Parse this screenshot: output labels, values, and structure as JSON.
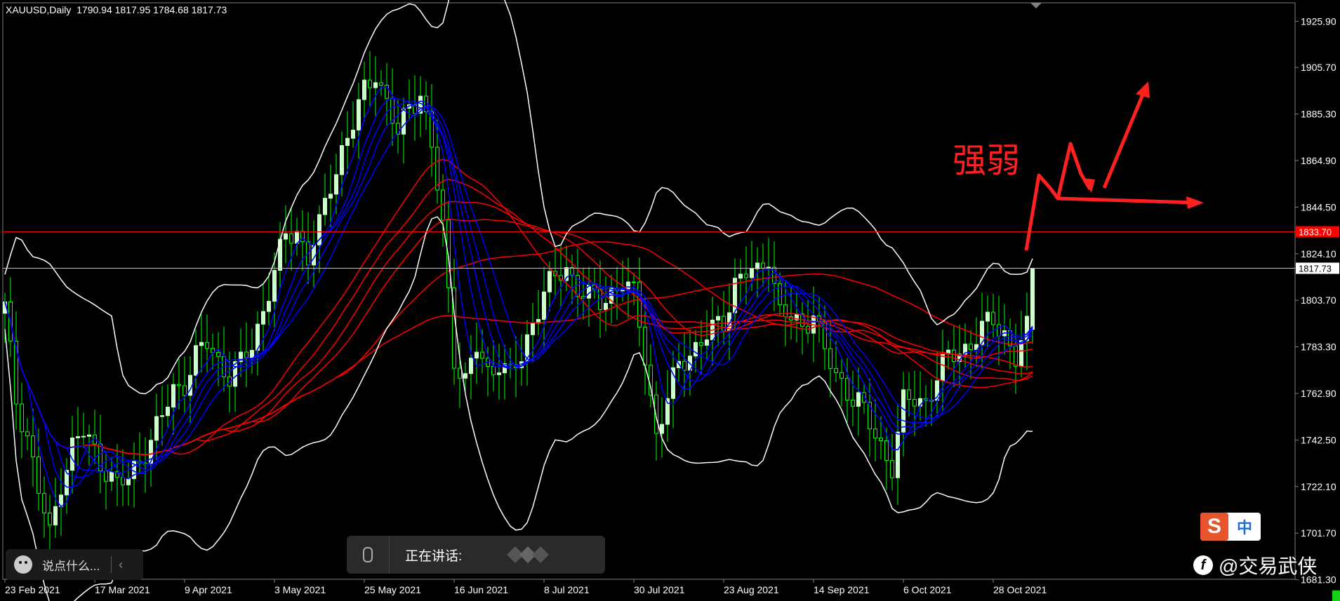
{
  "header": {
    "symbol": "XAUUSD,Daily",
    "ohlc": "1790.94 1817.95 1784.68 1817.73"
  },
  "colors": {
    "background": "#000000",
    "bull_candle": "#ccffcc",
    "bear_candle": "#00ff00",
    "bollinger": "#ffffff",
    "ma_fast": "#0000ff",
    "ma_slow": "#ff0000",
    "annotation": "#ff2020",
    "grid_text": "#ffffff"
  },
  "annotation_text": "强弱",
  "chat": {
    "placeholder": "说点什么...",
    "emoji_icon": "smile-icon",
    "collapse_icon": "chevron-left-icon"
  },
  "speaking": {
    "label": "正在讲话:",
    "mic_icon": "microphone-icon"
  },
  "logo": {
    "s_char": "S",
    "z_char": "中",
    "icon": "sogou-input-icon"
  },
  "watermark": {
    "text": "@交易武侠",
    "icon": "weibo-icon"
  },
  "chart_data": {
    "type": "candlestick",
    "symbol": "XAUUSD",
    "timeframe": "Daily",
    "ylim": [
      1681.5,
      1934
    ],
    "y_ticks": [
      1925.9,
      1905.7,
      1885.3,
      1864.9,
      1844.5,
      1824.1,
      1803.7,
      1783.3,
      1762.9,
      1742.5,
      1722.1,
      1701.7,
      1681.3
    ],
    "y_tick_labels": [
      "1925.90",
      "1905.70",
      "1885.30",
      "1864.90",
      "1844.50",
      "1824.10",
      "1803.70",
      "1783.30",
      "1762.90",
      "1742.50",
      "1722.10",
      "1701.70",
      "1681.30"
    ],
    "x_tick_labels": [
      "23 Feb 2021",
      "17 Mar 2021",
      "9 Apr 2021",
      "3 May 2021",
      "25 May 2021",
      "16 Jun 2021",
      "8 Jul 2021",
      "30 Jul 2021",
      "23 Aug 2021",
      "14 Sep 2021",
      "6 Oct 2021",
      "28 Oct 2021"
    ],
    "x_tick_index": [
      0,
      16,
      32,
      48,
      64,
      80,
      96,
      112,
      128,
      144,
      160,
      176
    ],
    "horizontal_lines": [
      {
        "price": 1833.7,
        "label": "1833.70",
        "color": "#ff0000",
        "label_bg": "#ff0000"
      },
      {
        "price": 1817.73,
        "label": "1817.73",
        "color": "#c0c0c0",
        "label_bg": "#ffffff"
      }
    ],
    "close_anchors": [
      [
        0,
        1800
      ],
      [
        2,
        1760
      ],
      [
        4,
        1745
      ],
      [
        6,
        1720
      ],
      [
        8,
        1700
      ],
      [
        10,
        1725
      ],
      [
        12,
        1740
      ],
      [
        14,
        1745
      ],
      [
        16,
        1738
      ],
      [
        18,
        1730
      ],
      [
        20,
        1722
      ],
      [
        22,
        1725
      ],
      [
        24,
        1735
      ],
      [
        26,
        1742
      ],
      [
        28,
        1752
      ],
      [
        30,
        1765
      ],
      [
        32,
        1768
      ],
      [
        34,
        1778
      ],
      [
        36,
        1785
      ],
      [
        38,
        1778
      ],
      [
        40,
        1770
      ],
      [
        42,
        1775
      ],
      [
        44,
        1785
      ],
      [
        46,
        1800
      ],
      [
        48,
        1815
      ],
      [
        50,
        1832
      ],
      [
        52,
        1835
      ],
      [
        54,
        1822
      ],
      [
        56,
        1835
      ],
      [
        58,
        1855
      ],
      [
        60,
        1870
      ],
      [
        62,
        1880
      ],
      [
        64,
        1895
      ],
      [
        66,
        1905
      ],
      [
        68,
        1890
      ],
      [
        70,
        1875
      ],
      [
        72,
        1890
      ],
      [
        74,
        1895
      ],
      [
        76,
        1870
      ],
      [
        78,
        1835
      ],
      [
        80,
        1780
      ],
      [
        82,
        1768
      ],
      [
        84,
        1782
      ],
      [
        86,
        1772
      ],
      [
        88,
        1778
      ],
      [
        90,
        1770
      ],
      [
        92,
        1778
      ],
      [
        94,
        1795
      ],
      [
        96,
        1808
      ],
      [
        98,
        1812
      ],
      [
        100,
        1818
      ],
      [
        102,
        1810
      ],
      [
        104,
        1805
      ],
      [
        106,
        1802
      ],
      [
        108,
        1808
      ],
      [
        110,
        1812
      ],
      [
        112,
        1805
      ],
      [
        114,
        1780
      ],
      [
        116,
        1745
      ],
      [
        118,
        1760
      ],
      [
        120,
        1775
      ],
      [
        122,
        1782
      ],
      [
        124,
        1785
      ],
      [
        126,
        1790
      ],
      [
        128,
        1795
      ],
      [
        130,
        1812
      ],
      [
        132,
        1815
      ],
      [
        134,
        1815
      ],
      [
        136,
        1825
      ],
      [
        138,
        1798
      ],
      [
        140,
        1795
      ],
      [
        142,
        1792
      ],
      [
        144,
        1800
      ],
      [
        146,
        1780
      ],
      [
        148,
        1770
      ],
      [
        150,
        1765
      ],
      [
        152,
        1760
      ],
      [
        154,
        1748
      ],
      [
        156,
        1740
      ],
      [
        158,
        1732
      ],
      [
        160,
        1758
      ],
      [
        162,
        1760
      ],
      [
        164,
        1760
      ],
      [
        166,
        1770
      ],
      [
        168,
        1778
      ],
      [
        170,
        1782
      ],
      [
        172,
        1785
      ],
      [
        174,
        1790
      ],
      [
        176,
        1795
      ],
      [
        178,
        1790
      ],
      [
        180,
        1778
      ],
      [
        182,
        1790
      ],
      [
        183,
        1817.73
      ]
    ],
    "last_candle": {
      "open": 1790.94,
      "high": 1817.95,
      "low": 1784.68,
      "close": 1817.73
    },
    "bollinger_note": "20-period bands, 2 std",
    "ma_fast_periods": [
      5,
      8,
      10,
      12,
      15
    ],
    "ma_slow_periods": [
      30,
      35,
      40,
      45,
      60,
      100
    ]
  }
}
